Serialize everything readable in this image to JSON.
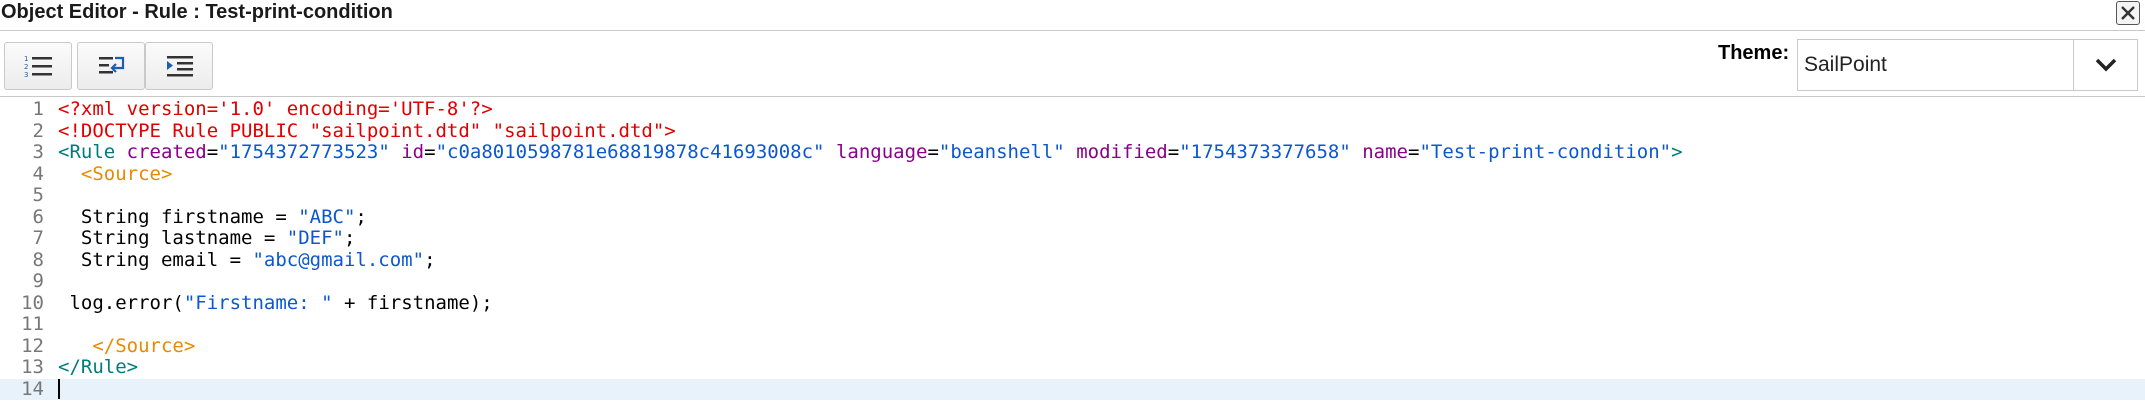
{
  "window": {
    "title": "Object Editor - Rule : Test-print-condition",
    "close_icon": "close-icon"
  },
  "toolbar": {
    "buttons": [
      {
        "name": "line-numbers-button",
        "icon": "numbered-list-icon"
      },
      {
        "name": "wrap-lines-button",
        "icon": "wrap-text-icon"
      },
      {
        "name": "indent-button",
        "icon": "indent-icon"
      }
    ],
    "theme_label": "Theme:",
    "theme_value": "SailPoint",
    "theme_arrow_icon": "chevron-down-icon"
  },
  "editor": {
    "active_line": 14,
    "lines": [
      {
        "n": "1",
        "tokens": [
          {
            "t": "<?xml version='1.0' encoding='UTF-8'?>",
            "c": "red"
          }
        ]
      },
      {
        "n": "2",
        "tokens": [
          {
            "t": "<!DOCTYPE Rule PUBLIC \"sailpoint.dtd\" \"sailpoint.dtd\">",
            "c": "red"
          }
        ]
      },
      {
        "n": "3",
        "tokens": [
          {
            "t": "<Rule ",
            "c": "tag"
          },
          {
            "t": "created",
            "c": "attr"
          },
          {
            "t": "=",
            "c": "plain"
          },
          {
            "t": "\"1754372773523\"",
            "c": "str"
          },
          {
            "t": " ",
            "c": "plain"
          },
          {
            "t": "id",
            "c": "attr"
          },
          {
            "t": "=",
            "c": "plain"
          },
          {
            "t": "\"c0a8010598781e68819878c41693008c\"",
            "c": "str"
          },
          {
            "t": " ",
            "c": "plain"
          },
          {
            "t": "language",
            "c": "attr"
          },
          {
            "t": "=",
            "c": "plain"
          },
          {
            "t": "\"beanshell\"",
            "c": "str"
          },
          {
            "t": " ",
            "c": "plain"
          },
          {
            "t": "modified",
            "c": "attr"
          },
          {
            "t": "=",
            "c": "plain"
          },
          {
            "t": "\"1754373377658\"",
            "c": "str"
          },
          {
            "t": " ",
            "c": "plain"
          },
          {
            "t": "name",
            "c": "attr"
          },
          {
            "t": "=",
            "c": "plain"
          },
          {
            "t": "\"Test-print-condition\"",
            "c": "str"
          },
          {
            "t": ">",
            "c": "tag"
          }
        ]
      },
      {
        "n": "4",
        "tokens": [
          {
            "t": "  ",
            "c": "plain"
          },
          {
            "t": "<Source>",
            "c": "orange"
          }
        ]
      },
      {
        "n": "5",
        "tokens": []
      },
      {
        "n": "6",
        "tokens": [
          {
            "t": "  String firstname = ",
            "c": "plain"
          },
          {
            "t": "\"ABC\"",
            "c": "str"
          },
          {
            "t": ";",
            "c": "plain"
          }
        ]
      },
      {
        "n": "7",
        "tokens": [
          {
            "t": "  String lastname = ",
            "c": "plain"
          },
          {
            "t": "\"DEF\"",
            "c": "str"
          },
          {
            "t": ";",
            "c": "plain"
          }
        ]
      },
      {
        "n": "8",
        "tokens": [
          {
            "t": "  String email = ",
            "c": "plain"
          },
          {
            "t": "\"abc@gmail.com\"",
            "c": "str"
          },
          {
            "t": ";",
            "c": "plain"
          }
        ]
      },
      {
        "n": "9",
        "tokens": []
      },
      {
        "n": "10",
        "tokens": [
          {
            "t": " log.error(",
            "c": "plain"
          },
          {
            "t": "\"Firstname: \"",
            "c": "str"
          },
          {
            "t": " + firstname);",
            "c": "plain"
          }
        ]
      },
      {
        "n": "11",
        "tokens": []
      },
      {
        "n": "12",
        "tokens": [
          {
            "t": "   ",
            "c": "plain"
          },
          {
            "t": "</Source>",
            "c": "orange"
          }
        ]
      },
      {
        "n": "13",
        "tokens": [
          {
            "t": "</Rule>",
            "c": "tag"
          }
        ]
      },
      {
        "n": "14",
        "tokens": []
      }
    ]
  },
  "colors": {
    "xml_decl": "#e00000",
    "tag": "#007b7b",
    "attribute": "#8b008b",
    "string": "#0b57d0",
    "source_tag": "#e88a00",
    "active_line_bg": "#e8f2fb"
  }
}
